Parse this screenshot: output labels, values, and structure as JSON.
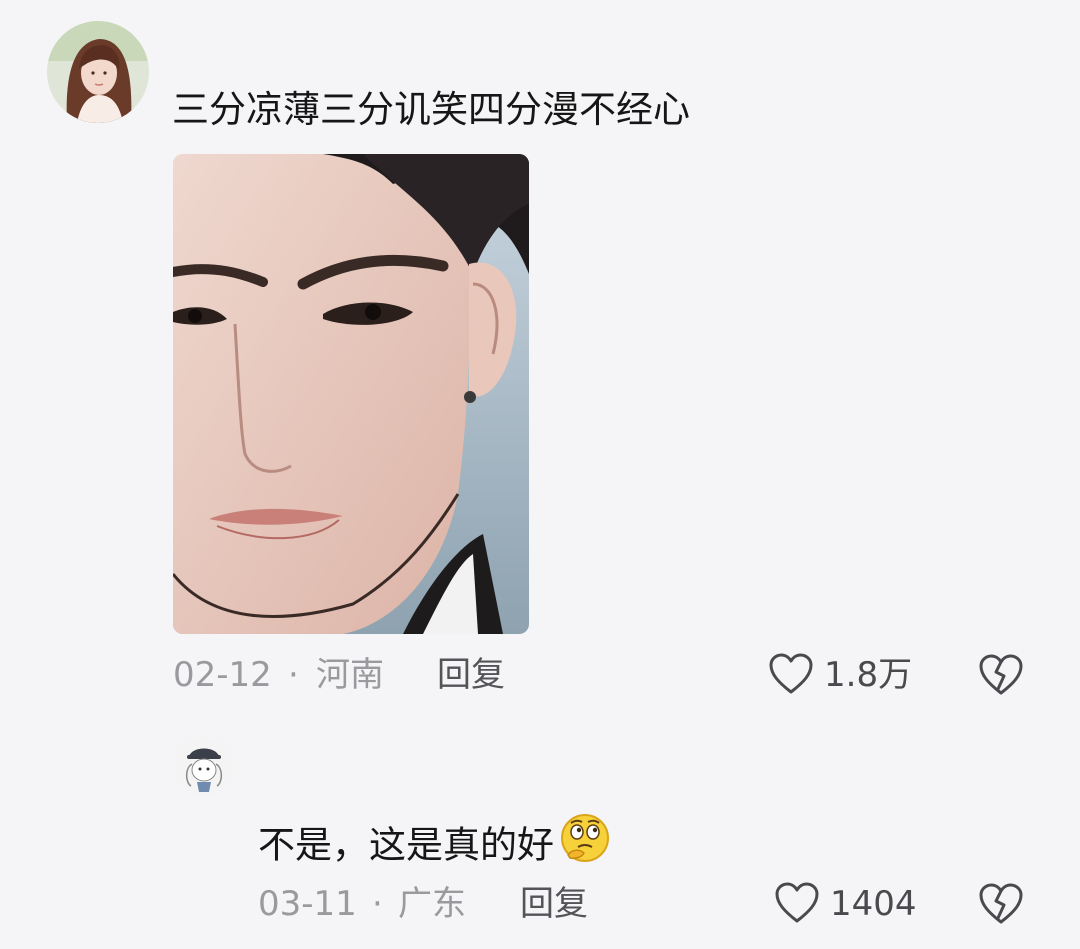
{
  "comments": [
    {
      "text": "三分凉薄三分讥笑四分漫不经心",
      "date": "02-12",
      "separator": "·",
      "location": "河南",
      "reply_label": "回复",
      "likes": "1.8万",
      "has_image": true,
      "avatar": "avatar-woman-long-hair"
    },
    {
      "text": "不是，这是真的好",
      "emoji": "thinking-face-emoji",
      "date": "03-11",
      "separator": "·",
      "location": "广东",
      "reply_label": "回复",
      "likes": "1404",
      "avatar": "avatar-cartoon-character"
    }
  ],
  "icons": {
    "like": "heart-outline-icon",
    "dislike": "broken-heart-icon"
  },
  "colors": {
    "background": "#f5f5f7",
    "text_primary": "#161616",
    "text_secondary": "#9a9a9e",
    "icon": "#4a4a4e"
  }
}
